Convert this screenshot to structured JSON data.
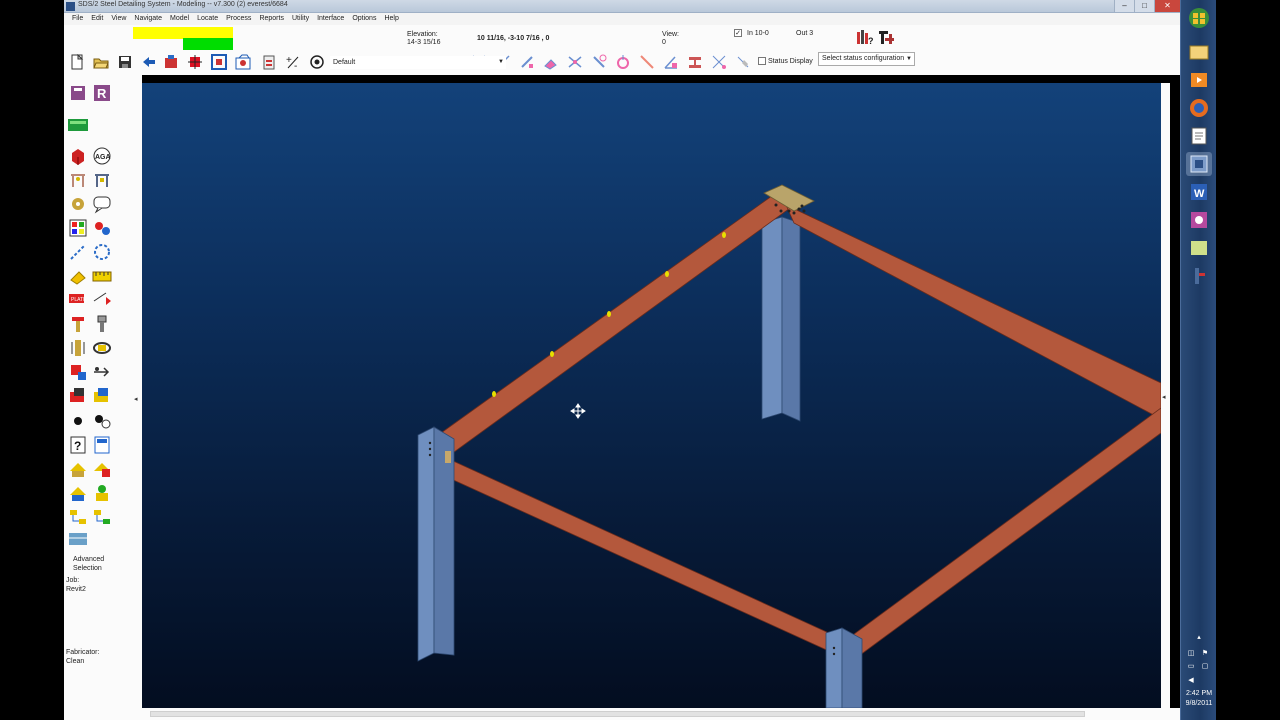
{
  "window": {
    "title": "SDS/2 Steel Detailing System - Modeling  -- v7.300  (2) everest/6684",
    "controls": [
      "minimize",
      "maximize",
      "close"
    ]
  },
  "menu": [
    "File",
    "Edit",
    "View",
    "Navigate",
    "Model",
    "Locate",
    "Process",
    "Reports",
    "Utility",
    "Interface",
    "Options",
    "Help"
  ],
  "status": {
    "status_colors": [
      "#ffff00",
      "#00dd00"
    ],
    "elevation_label": "Elevation:",
    "elevation_value": "14-3 15/16",
    "coordinates": "10 11/16,  -3-10 7/16 , 0",
    "view_label": "View:",
    "view_value": "0",
    "in_label": "In 10-0",
    "in_checked": true,
    "out_label": "Out 3"
  },
  "toolbar": {
    "view_dropdown": "Default",
    "status_display_label": "Status Display",
    "status_display_checked": false,
    "status_config_placeholder": "Select status configuration"
  },
  "palette": {
    "advanced_selection": [
      "Advanced",
      "Selection"
    ],
    "job_label": "Job:",
    "job_value": "Revit2",
    "fabricator_label": "Fabricator:",
    "fabricator_value": "Clean"
  },
  "model": {
    "beam_color": "#b4583c",
    "column_color": "#6f8fbf"
  },
  "taskbar": {
    "time": "2:42 PM",
    "date": "9/8/2011"
  }
}
